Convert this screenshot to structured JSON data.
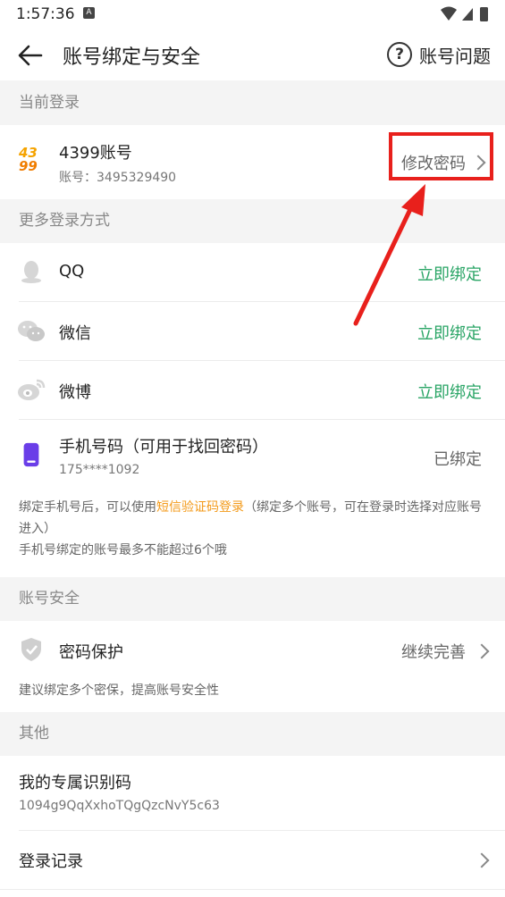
{
  "status": {
    "time": "1:57:36",
    "a_badge": "A"
  },
  "header": {
    "title": "账号绑定与安全",
    "help_label": "账号问题"
  },
  "sections": {
    "current_login": "当前登录",
    "more_login": "更多登录方式",
    "account_security": "账号安全",
    "other": "其他"
  },
  "current_account": {
    "name": "4399账号",
    "account_no": "账号：3495329490",
    "change_password": "修改密码",
    "logo_top": "43",
    "logo_bottom": "99"
  },
  "bindings": [
    {
      "name": "QQ",
      "action": "立即绑定"
    },
    {
      "name": "微信",
      "action": "立即绑定"
    },
    {
      "name": "微博",
      "action": "立即绑定"
    }
  ],
  "phone": {
    "title": "手机号码（可用于找回密码）",
    "number": "175****1092",
    "status": "已绑定"
  },
  "phone_note": {
    "part1": "绑定手机号后，可以使用",
    "highlight": "短信验证码登录",
    "part2": "（绑定多个账号，可在登录时选择对应账号进入）",
    "line2": "手机号绑定的账号最多不能超过6个哦"
  },
  "security": {
    "title": "密码保护",
    "action": "继续完善",
    "note": "建议绑定多个密保，提高账号安全性"
  },
  "other": {
    "id_title": "我的专属识别码",
    "id_value": "1094g9QqXxhoTQgQzcNvY5c63",
    "login_records": "登录记录"
  },
  "colors": {
    "accent_green": "#2aa566",
    "highlight_orange": "#f39a1a",
    "annotation_red": "#e8201c"
  }
}
